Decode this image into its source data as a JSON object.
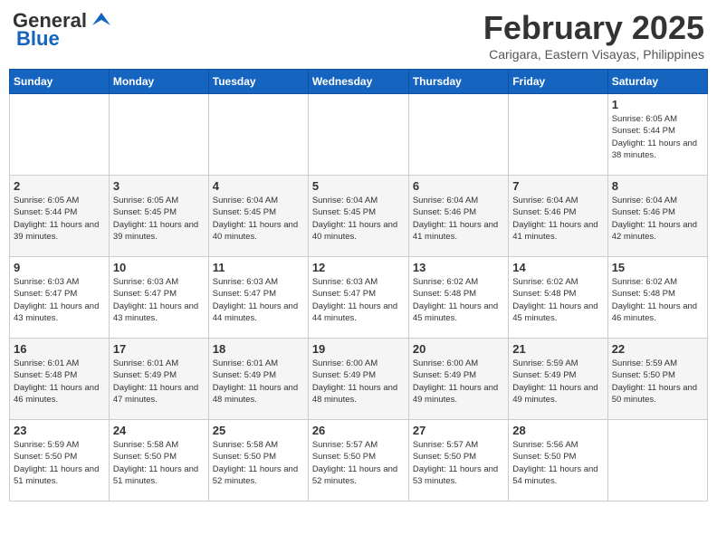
{
  "logo": {
    "general": "General",
    "blue": "Blue"
  },
  "header": {
    "month_year": "February 2025",
    "location": "Carigara, Eastern Visayas, Philippines"
  },
  "days_of_week": [
    "Sunday",
    "Monday",
    "Tuesday",
    "Wednesday",
    "Thursday",
    "Friday",
    "Saturday"
  ],
  "weeks": [
    [
      {
        "day": "",
        "info": ""
      },
      {
        "day": "",
        "info": ""
      },
      {
        "day": "",
        "info": ""
      },
      {
        "day": "",
        "info": ""
      },
      {
        "day": "",
        "info": ""
      },
      {
        "day": "",
        "info": ""
      },
      {
        "day": "1",
        "info": "Sunrise: 6:05 AM\nSunset: 5:44 PM\nDaylight: 11 hours and 38 minutes."
      }
    ],
    [
      {
        "day": "2",
        "info": "Sunrise: 6:05 AM\nSunset: 5:44 PM\nDaylight: 11 hours and 39 minutes."
      },
      {
        "day": "3",
        "info": "Sunrise: 6:05 AM\nSunset: 5:45 PM\nDaylight: 11 hours and 39 minutes."
      },
      {
        "day": "4",
        "info": "Sunrise: 6:04 AM\nSunset: 5:45 PM\nDaylight: 11 hours and 40 minutes."
      },
      {
        "day": "5",
        "info": "Sunrise: 6:04 AM\nSunset: 5:45 PM\nDaylight: 11 hours and 40 minutes."
      },
      {
        "day": "6",
        "info": "Sunrise: 6:04 AM\nSunset: 5:46 PM\nDaylight: 11 hours and 41 minutes."
      },
      {
        "day": "7",
        "info": "Sunrise: 6:04 AM\nSunset: 5:46 PM\nDaylight: 11 hours and 41 minutes."
      },
      {
        "day": "8",
        "info": "Sunrise: 6:04 AM\nSunset: 5:46 PM\nDaylight: 11 hours and 42 minutes."
      }
    ],
    [
      {
        "day": "9",
        "info": "Sunrise: 6:03 AM\nSunset: 5:47 PM\nDaylight: 11 hours and 43 minutes."
      },
      {
        "day": "10",
        "info": "Sunrise: 6:03 AM\nSunset: 5:47 PM\nDaylight: 11 hours and 43 minutes."
      },
      {
        "day": "11",
        "info": "Sunrise: 6:03 AM\nSunset: 5:47 PM\nDaylight: 11 hours and 44 minutes."
      },
      {
        "day": "12",
        "info": "Sunrise: 6:03 AM\nSunset: 5:47 PM\nDaylight: 11 hours and 44 minutes."
      },
      {
        "day": "13",
        "info": "Sunrise: 6:02 AM\nSunset: 5:48 PM\nDaylight: 11 hours and 45 minutes."
      },
      {
        "day": "14",
        "info": "Sunrise: 6:02 AM\nSunset: 5:48 PM\nDaylight: 11 hours and 45 minutes."
      },
      {
        "day": "15",
        "info": "Sunrise: 6:02 AM\nSunset: 5:48 PM\nDaylight: 11 hours and 46 minutes."
      }
    ],
    [
      {
        "day": "16",
        "info": "Sunrise: 6:01 AM\nSunset: 5:48 PM\nDaylight: 11 hours and 46 minutes."
      },
      {
        "day": "17",
        "info": "Sunrise: 6:01 AM\nSunset: 5:49 PM\nDaylight: 11 hours and 47 minutes."
      },
      {
        "day": "18",
        "info": "Sunrise: 6:01 AM\nSunset: 5:49 PM\nDaylight: 11 hours and 48 minutes."
      },
      {
        "day": "19",
        "info": "Sunrise: 6:00 AM\nSunset: 5:49 PM\nDaylight: 11 hours and 48 minutes."
      },
      {
        "day": "20",
        "info": "Sunrise: 6:00 AM\nSunset: 5:49 PM\nDaylight: 11 hours and 49 minutes."
      },
      {
        "day": "21",
        "info": "Sunrise: 5:59 AM\nSunset: 5:49 PM\nDaylight: 11 hours and 49 minutes."
      },
      {
        "day": "22",
        "info": "Sunrise: 5:59 AM\nSunset: 5:50 PM\nDaylight: 11 hours and 50 minutes."
      }
    ],
    [
      {
        "day": "23",
        "info": "Sunrise: 5:59 AM\nSunset: 5:50 PM\nDaylight: 11 hours and 51 minutes."
      },
      {
        "day": "24",
        "info": "Sunrise: 5:58 AM\nSunset: 5:50 PM\nDaylight: 11 hours and 51 minutes."
      },
      {
        "day": "25",
        "info": "Sunrise: 5:58 AM\nSunset: 5:50 PM\nDaylight: 11 hours and 52 minutes."
      },
      {
        "day": "26",
        "info": "Sunrise: 5:57 AM\nSunset: 5:50 PM\nDaylight: 11 hours and 52 minutes."
      },
      {
        "day": "27",
        "info": "Sunrise: 5:57 AM\nSunset: 5:50 PM\nDaylight: 11 hours and 53 minutes."
      },
      {
        "day": "28",
        "info": "Sunrise: 5:56 AM\nSunset: 5:50 PM\nDaylight: 11 hours and 54 minutes."
      },
      {
        "day": "",
        "info": ""
      }
    ]
  ]
}
